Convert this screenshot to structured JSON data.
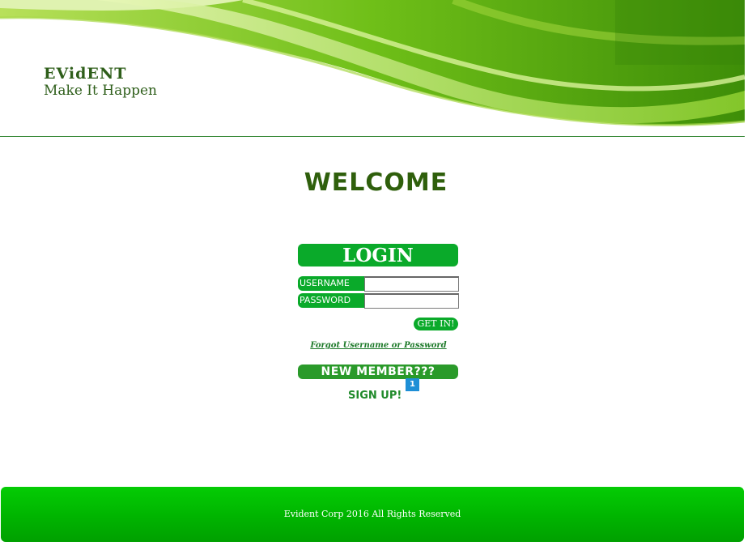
{
  "header": {
    "brand_name": "EVidENT",
    "brand_tagline": "Make It Happen"
  },
  "main": {
    "welcome": "WELCOME",
    "login_title": "LOGIN",
    "username_label": "USERNAME",
    "username_value": "",
    "password_label": "PASSWORD",
    "password_value": "",
    "submit_label": "GET IN!",
    "forgot_link": "Forgot Username or Password",
    "new_member_label": "NEW MEMBER???",
    "badge_count": "1",
    "signup_link": "SIGN UP!"
  },
  "footer": {
    "copyright": "Evident Corp  2016 All Rights Reserved"
  },
  "colors": {
    "brand_green": "#0aaa2a",
    "dark_green": "#2f5f0c",
    "footer_green": "#00b400",
    "badge_blue": "#1e8fd6"
  }
}
